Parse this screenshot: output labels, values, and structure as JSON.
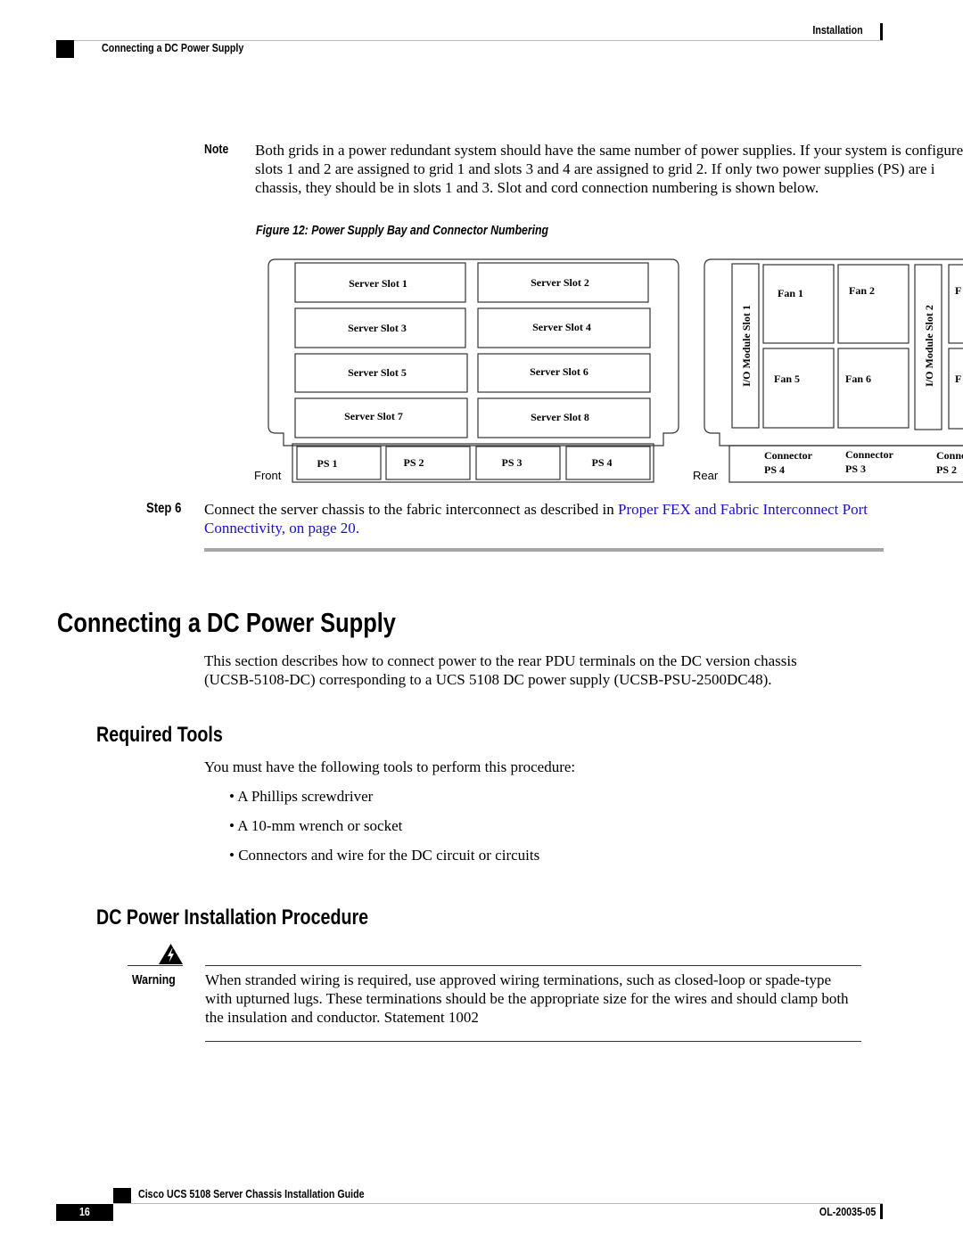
{
  "header": {
    "chapter": "Installation",
    "section": "Connecting a DC Power Supply"
  },
  "note": {
    "label": "Note",
    "lines": [
      "Both grids in a power redundant system should have the same number of power supplies. If your system is configured",
      "slots 1 and 2 are assigned to grid 1 and slots 3 and 4 are assigned to grid 2. If only two power supplies (PS) are i",
      "chassis, they should be in slots 1 and 3. Slot and cord connection numbering is shown below."
    ]
  },
  "figure": {
    "caption": "Figure 12: Power Supply Bay and Connector Numbering",
    "front_label": "Front",
    "rear_label": "Rear",
    "server_slots": [
      "Server Slot 1",
      "Server Slot 2",
      "Server Slot 3",
      "Server Slot 4",
      "Server Slot 5",
      "Server Slot 6",
      "Server Slot 7",
      "Server Slot 8"
    ],
    "power_supplies": [
      "PS 1",
      "PS 2",
      "PS 3",
      "PS 4"
    ],
    "io_modules": [
      "I/O Module Slot 1",
      "I/O Module Slot 2"
    ],
    "fans": [
      "Fan 1",
      "Fan 2",
      "Fan 5",
      "Fan 6",
      "F",
      "F"
    ],
    "connectors": [
      {
        "label": "Connector",
        "ps": "PS 4"
      },
      {
        "label": "Connector",
        "ps": "PS 3"
      },
      {
        "label": "Conne",
        "ps": "PS 2"
      }
    ]
  },
  "step6": {
    "label": "Step 6",
    "text": "Connect the server chassis to the fabric interconnect as described in ",
    "link1": "Proper FEX and Fabric Interconnect Port",
    "link2": "Connectivity,  on page 20",
    "end": "."
  },
  "section": {
    "title": "Connecting a DC Power Supply",
    "intro_lines": [
      "This section describes how to connect power to the rear PDU terminals on the DC version chassis",
      "(UCSB-5108-DC) corresponding to a UCS 5108 DC power supply (UCSB-PSU-2500DC48)."
    ]
  },
  "required_tools": {
    "title": "Required Tools",
    "intro": "You must have the following tools to perform this procedure:",
    "items": [
      "A Phillips screwdriver",
      "A 10-mm wrench or socket",
      "Connectors and wire for the DC circuit or circuits"
    ]
  },
  "procedure": {
    "title": "DC Power Installation Procedure",
    "warning_label": "Warning",
    "warning_icon": "warning-triangle-icon",
    "warning_lines": [
      "When stranded wiring is required, use approved wiring terminations, such as closed-loop or spade-type",
      "with upturned lugs. These terminations should be the appropriate size for the wires and should clamp both",
      "the insulation and conductor. Statement 1002"
    ]
  },
  "footer": {
    "guide_title": "Cisco UCS 5108 Server Chassis Installation Guide",
    "page_number": "16",
    "doc_id": "OL-20035-05"
  },
  "colors": {
    "link": "#1a0dcc",
    "rule": "#a6a6a6"
  }
}
